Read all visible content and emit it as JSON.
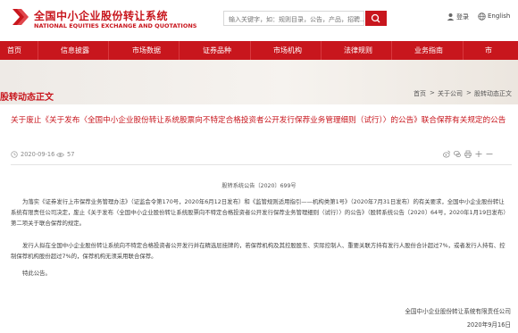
{
  "header": {
    "logo_cn": "全国中小企业股份转让系统",
    "logo_en": "NATIONAL EQUITIES EXCHANGE AND QUOTATIONS",
    "search_placeholder": "输入关键字，如：规则目录，公告，产品，招聘...",
    "login_label": "登录",
    "english_label": "English"
  },
  "nav": {
    "items": [
      "首页",
      "信息披露",
      "市场数据",
      "证券品种",
      "市场机构",
      "法律规则",
      "业务指南",
      "市"
    ]
  },
  "banner": {
    "title": "股转动态正文",
    "breadcrumb": [
      "首页",
      "关于公司",
      "股转动态正文"
    ],
    "breadcrumb_sep": ">"
  },
  "article": {
    "title": "关于废止《关于发布〈全国中小企业股份转让系统股票向不特定合格投资者公开发行保荐业务管理细则（试行）〉的公告》联合保荐有关规定的公告",
    "date": "2020-09-16",
    "views": "57",
    "doc_number": "股转系统公告〔2020〕699号",
    "paragraphs": [
      "为落实《证券发行上市保荐业务管理办法》（证监会令第170号，2020年6月12日发布）和《监管规则适用指引——机构类第1号》（2020年7月31日发布）的有关要求，全国中小企业股份转让系统有限责任公司决定，废止《关于发布〈全国中小企业股份转让系统股票向不特定合格投资者公开发行保荐业务管理细则（试行）〉的公告》（股转系统公告〔2020〕64号，2020年1月19日发布）第二项关于联合保荐的规定。",
      "发行人拟在全国中小企业股份转让系统向不特定合格投资者公开发行并在精选层挂牌的，若保荐机构及其控股股东、实际控制人、重要关联方持有发行人股份合计超过7%，或者发行人持有、控制保荐机构股份超过7%的，保荐机构无须采用联合保荐。",
      "特此公告。"
    ],
    "signature_org": "全国中小企业股份转让系统有限责任公司",
    "signature_date": "2020年9月16日"
  },
  "icons": {
    "logo": "neeq-logo-icon",
    "search": "search-icon",
    "user": "user-icon",
    "globe": "globe-icon",
    "clock": "clock-icon",
    "eye": "eye-icon",
    "share": [
      "weibo-icon",
      "wechat-icon",
      "print-icon",
      "font-larger-icon",
      "font-smaller-icon"
    ]
  },
  "colors": {
    "brand_red": "#c8161d",
    "banner_bg": "#f3efea"
  }
}
